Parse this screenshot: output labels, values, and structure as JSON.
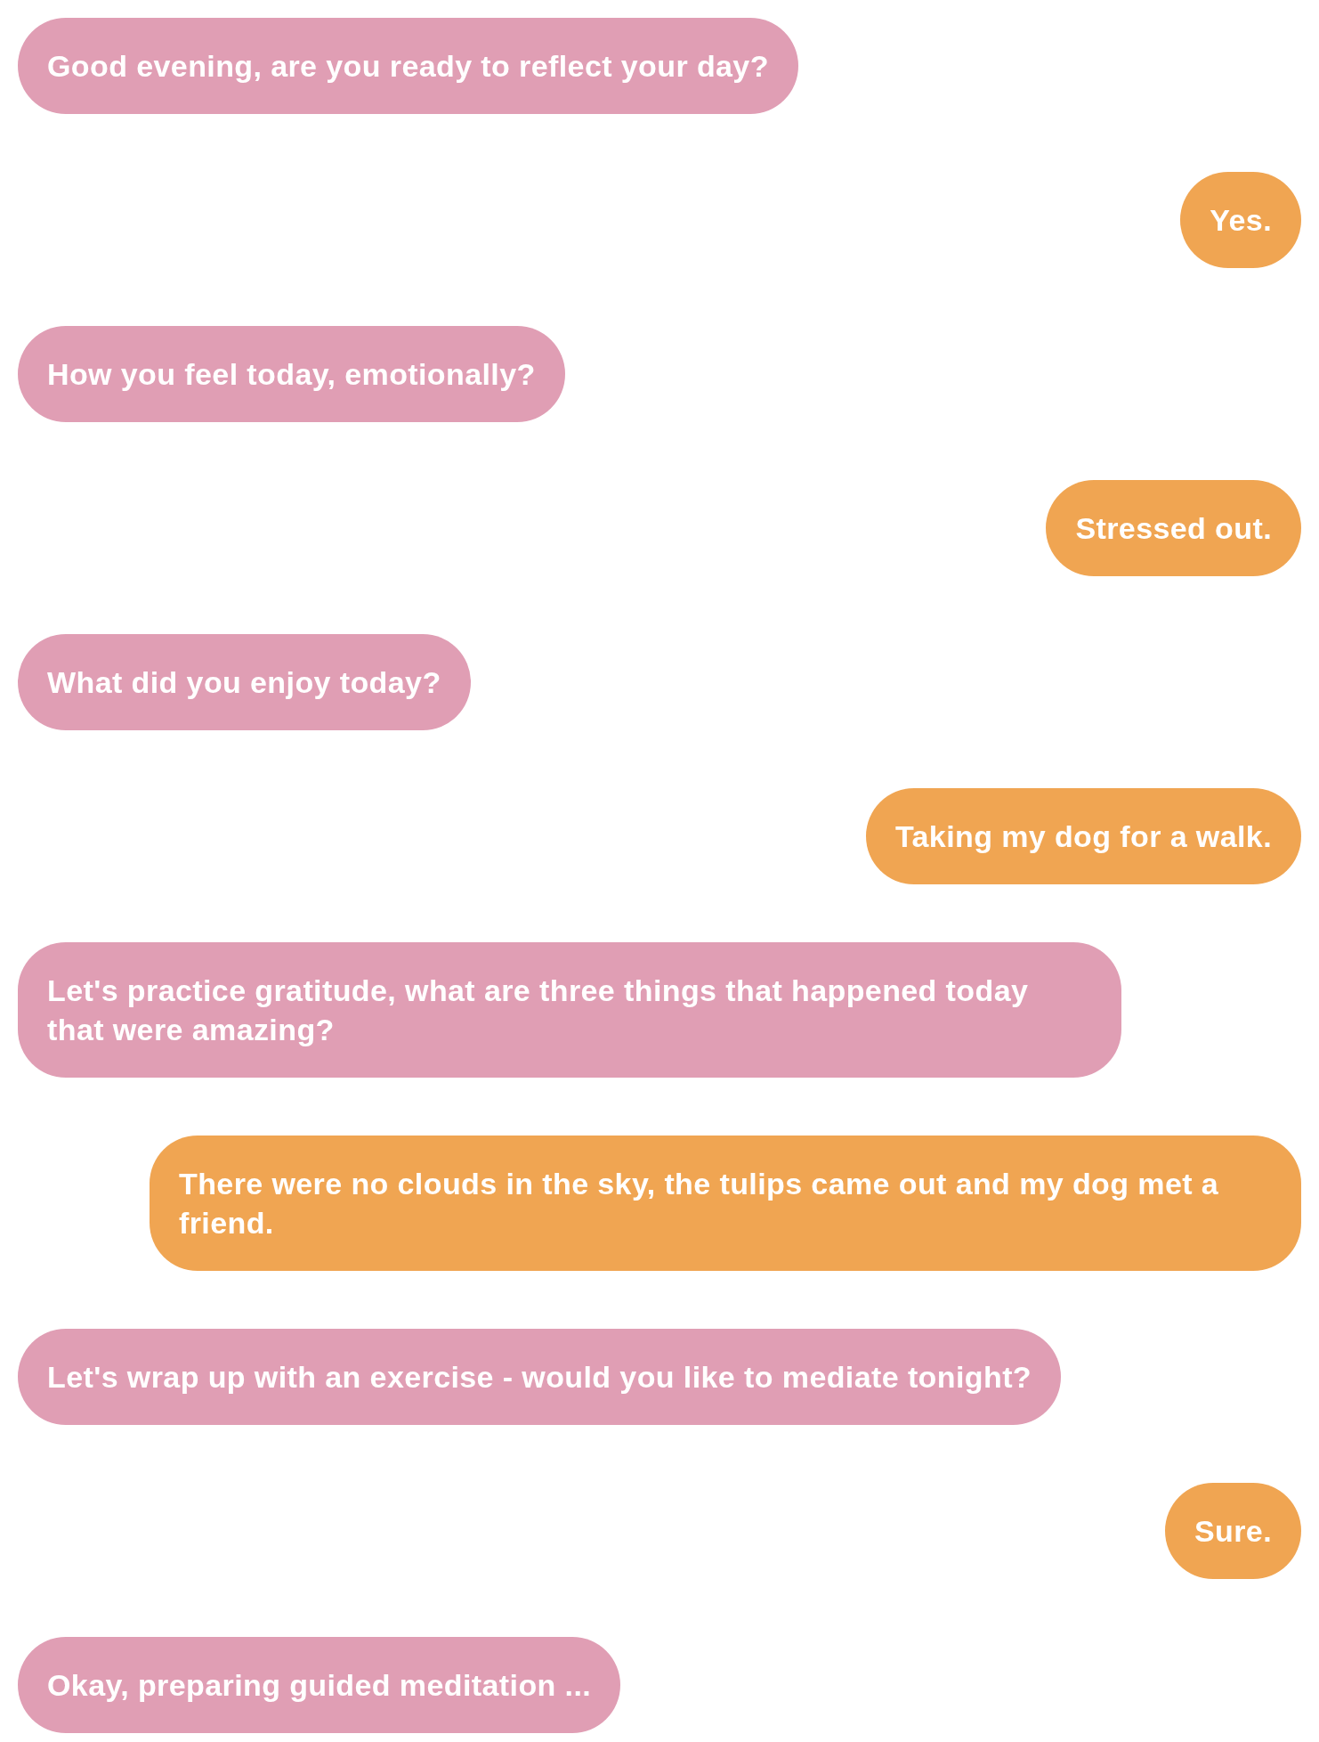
{
  "messages": [
    {
      "kind": "incoming",
      "text": "Good evening, are you ready to reflect your day?"
    },
    {
      "kind": "outgoing",
      "text": "Yes."
    },
    {
      "kind": "incoming",
      "text": "How you feel today, emotionally?"
    },
    {
      "kind": "outgoing",
      "text": "Stressed out."
    },
    {
      "kind": "incoming",
      "text": "What did you enjoy today?"
    },
    {
      "kind": "outgoing",
      "text": "Taking my dog for a walk."
    },
    {
      "kind": "incoming",
      "text": "Let's practice gratitude, what are three things that happened today that were amazing?"
    },
    {
      "kind": "outgoing",
      "text": "There were no clouds in the sky, the tulips came out and my dog met a friend."
    },
    {
      "kind": "incoming",
      "text": "Let's wrap up with an exercise - would you like to mediate tonight?"
    },
    {
      "kind": "outgoing",
      "text": "Sure."
    },
    {
      "kind": "incoming",
      "text": "Okay, preparing guided meditation ..."
    }
  ]
}
